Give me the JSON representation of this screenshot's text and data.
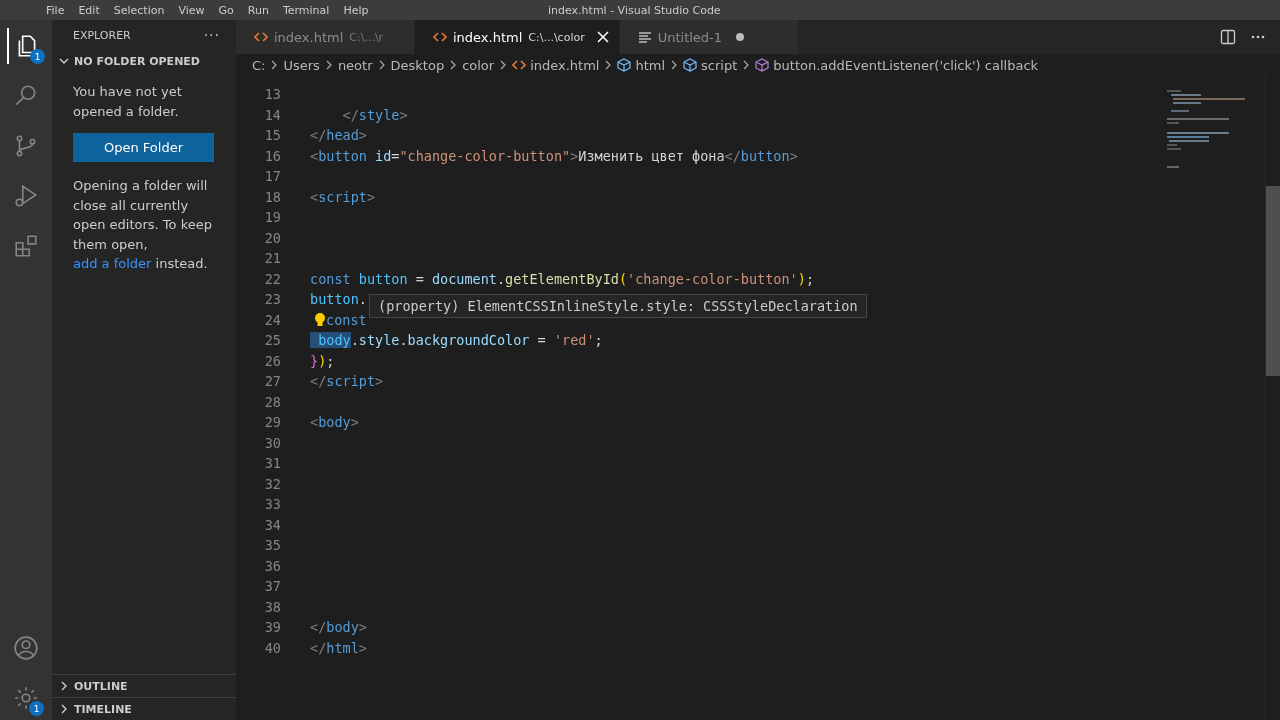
{
  "title_bar": {
    "menu": [
      "File",
      "Edit",
      "Selection",
      "View",
      "Go",
      "Run",
      "Terminal",
      "Help"
    ],
    "title": "index.html - Visual Studio Code"
  },
  "activity_bar": {
    "top": [
      {
        "kind": "files",
        "selected": true,
        "badge": "1"
      },
      {
        "kind": "search",
        "selected": false
      },
      {
        "kind": "source-control",
        "selected": false
      },
      {
        "kind": "run-debug",
        "selected": false
      },
      {
        "kind": "extensions",
        "selected": false
      }
    ],
    "bottom": [
      {
        "kind": "account",
        "selected": false
      },
      {
        "kind": "settings",
        "selected": false,
        "badge": "1"
      }
    ]
  },
  "sidebar": {
    "title": "EXPLORER",
    "more": "···",
    "section": {
      "title": "NO FOLDER OPENED",
      "expanded": true
    },
    "message": "You have not yet opened a folder.",
    "open_button": "Open Folder",
    "note": {
      "before": "Opening a folder will close all currently open editors. To keep them open, ",
      "link": "add a folder",
      "after": " instead."
    },
    "panels": [
      {
        "title": "OUTLINE",
        "expanded": false
      },
      {
        "title": "TIMELINE",
        "expanded": false
      }
    ]
  },
  "tabs": [
    {
      "label": "index.html",
      "path": "C:\\...\\r",
      "kind": "html",
      "selected": false,
      "dirty": false
    },
    {
      "label": "index.html",
      "path": "C:\\...\\color",
      "kind": "html",
      "selected": true,
      "dirty": false
    },
    {
      "label": "Untitled-1",
      "kind": "text",
      "selected": false,
      "dirty": true
    }
  ],
  "breadcrumbs": [
    {
      "label": "C:",
      "kind": "folder"
    },
    {
      "label": "Users",
      "kind": "folder"
    },
    {
      "label": "neotr",
      "kind": "folder"
    },
    {
      "label": "Desktop",
      "kind": "folder"
    },
    {
      "label": "color",
      "kind": "folder"
    },
    {
      "label": "index.html",
      "kind": "html"
    },
    {
      "label": "html",
      "kind": "element"
    },
    {
      "label": "script",
      "kind": "element"
    },
    {
      "label": "button.addEventListener('click') callback",
      "kind": "method"
    }
  ],
  "editor": {
    "lines": [
      {
        "number": "13"
      },
      {
        "number": "14",
        "tokens": [
          {
            "kind": "angle",
            "text": "    </"
          },
          {
            "kind": "tag",
            "text": "style"
          },
          {
            "kind": "angle",
            "text": ">"
          }
        ]
      },
      {
        "number": "15",
        "tokens": [
          {
            "kind": "angle",
            "text": "</"
          },
          {
            "kind": "tag",
            "text": "head"
          },
          {
            "kind": "angle",
            "text": ">"
          }
        ]
      },
      {
        "number": "16",
        "tokens": [
          {
            "kind": "angle",
            "text": "<"
          },
          {
            "kind": "tag",
            "text": "button"
          },
          {
            "kind": "attr",
            "text": " id"
          },
          {
            "kind": "text",
            "text": "="
          },
          {
            "kind": "string",
            "text": "\"change-color-button\""
          },
          {
            "kind": "angle",
            "text": ">"
          },
          {
            "kind": "text",
            "text": "Изменить цвет фона"
          },
          {
            "kind": "angle",
            "text": "</"
          },
          {
            "kind": "tag",
            "text": "button"
          },
          {
            "kind": "angle",
            "text": ">"
          }
        ]
      },
      {
        "number": "17"
      },
      {
        "number": "18",
        "tokens": [
          {
            "kind": "angle",
            "text": "<"
          },
          {
            "kind": "tag",
            "text": "script"
          },
          {
            "kind": "angle",
            "text": ">"
          }
        ]
      },
      {
        "number": "19"
      },
      {
        "number": "20"
      },
      {
        "number": "21"
      },
      {
        "number": "22",
        "tokens": [
          {
            "kind": "keyword",
            "text": "const"
          },
          {
            "kind": "variable",
            "text": " button"
          },
          {
            "kind": "text",
            "text": " = "
          },
          {
            "kind": "property",
            "text": "document"
          },
          {
            "kind": "text",
            "text": "."
          },
          {
            "kind": "function",
            "text": "getElementById"
          },
          {
            "kind": "bracket1",
            "text": "("
          },
          {
            "kind": "string",
            "text": "'change-color-button'"
          },
          {
            "kind": "bracket1",
            "text": ")"
          },
          {
            "kind": "text",
            "text": ";"
          }
        ]
      },
      {
        "number": "23",
        "tokens": [
          {
            "kind": "variable",
            "text": "button"
          },
          {
            "kind": "text",
            "text": "."
          }
        ]
      },
      {
        "number": "24",
        "tokens": [
          {
            "kind": "bulb"
          },
          {
            "kind": "keyword",
            "text": "const"
          }
        ]
      },
      {
        "number": "25",
        "tokens": [
          {
            "kind": "selection",
            "text": " body"
          },
          {
            "kind": "text",
            "text": "."
          },
          {
            "kind": "property",
            "text": "style"
          },
          {
            "kind": "text",
            "text": "."
          },
          {
            "kind": "property",
            "text": "backgroundColor"
          },
          {
            "kind": "text",
            "text": " = "
          },
          {
            "kind": "string",
            "text": "'red'"
          },
          {
            "kind": "text",
            "text": ";"
          }
        ]
      },
      {
        "number": "26",
        "tokens": [
          {
            "kind": "bracket2",
            "text": "}"
          },
          {
            "kind": "bracket1",
            "text": ")"
          },
          {
            "kind": "text",
            "text": ";"
          }
        ]
      },
      {
        "number": "27",
        "tokens": [
          {
            "kind": "angle",
            "text": "</"
          },
          {
            "kind": "tag",
            "text": "script"
          },
          {
            "kind": "angle",
            "text": ">"
          }
        ]
      },
      {
        "number": "28"
      },
      {
        "number": "29",
        "tokens": [
          {
            "kind": "angle",
            "text": "<"
          },
          {
            "kind": "tag",
            "text": "body"
          },
          {
            "kind": "angle",
            "text": ">"
          }
        ]
      },
      {
        "number": "30"
      },
      {
        "number": "31"
      },
      {
        "number": "32"
      },
      {
        "number": "33"
      },
      {
        "number": "34"
      },
      {
        "number": "35"
      },
      {
        "number": "36"
      },
      {
        "number": "37"
      },
      {
        "number": "38"
      },
      {
        "number": "39",
        "tokens": [
          {
            "kind": "angle",
            "text": "</"
          },
          {
            "kind": "tag",
            "text": "body"
          },
          {
            "kind": "angle",
            "text": ">"
          }
        ]
      },
      {
        "number": "40",
        "tokens": [
          {
            "kind": "angle",
            "text": "</"
          },
          {
            "kind": "tag",
            "text": "html"
          },
          {
            "kind": "angle",
            "text": ">"
          }
        ]
      }
    ],
    "tooltip": "(property) ElementCSSInlineStyle.style: CSSStyleDeclaration"
  }
}
